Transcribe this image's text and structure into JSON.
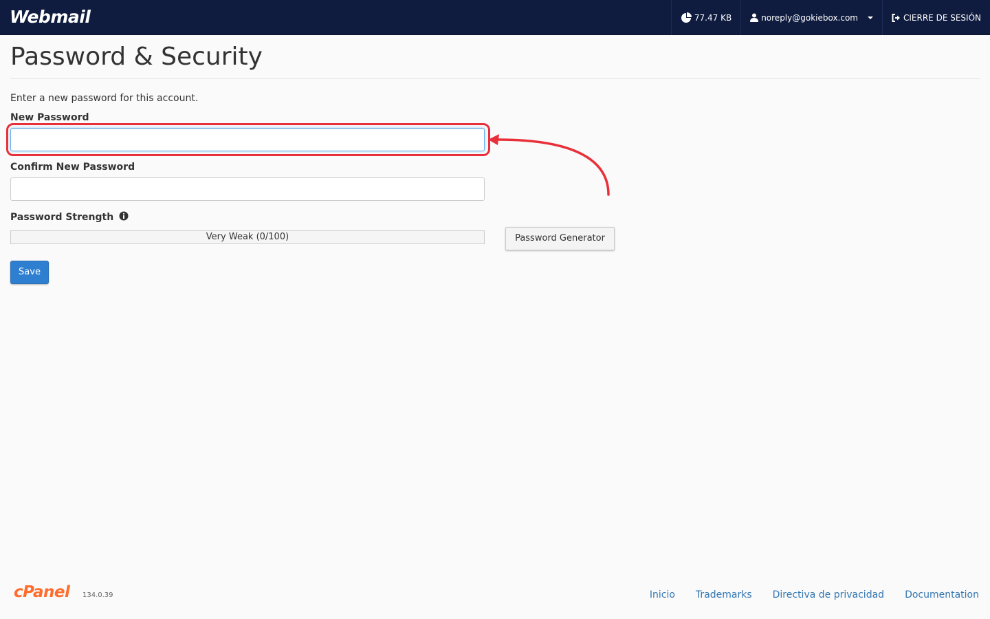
{
  "header": {
    "brand": "Webmail",
    "disk_usage": "77.47 KB",
    "account": "noreply@gokiebox.com",
    "logout": "CIERRE DE SESIÓN",
    "background_color": "#0f1c3f"
  },
  "main": {
    "title": "Password & Security",
    "intro": "Enter a new password for this account.",
    "new_password_label": "New Password",
    "new_password_value": "",
    "confirm_password_label": "Confirm New Password",
    "confirm_password_value": "",
    "strength_label": "Password Strength",
    "strength_text": "Very Weak (0/100)",
    "strength_score": 0,
    "generator_button": "Password Generator",
    "save_button": "Save"
  },
  "annotation": {
    "highlight_color": "#e8303a"
  },
  "footer": {
    "logo": "cPanel",
    "version": "134.0.39",
    "links": [
      "Inicio",
      "Trademarks",
      "Directiva de privacidad",
      "Documentation"
    ],
    "link_color": "#3276b1"
  }
}
